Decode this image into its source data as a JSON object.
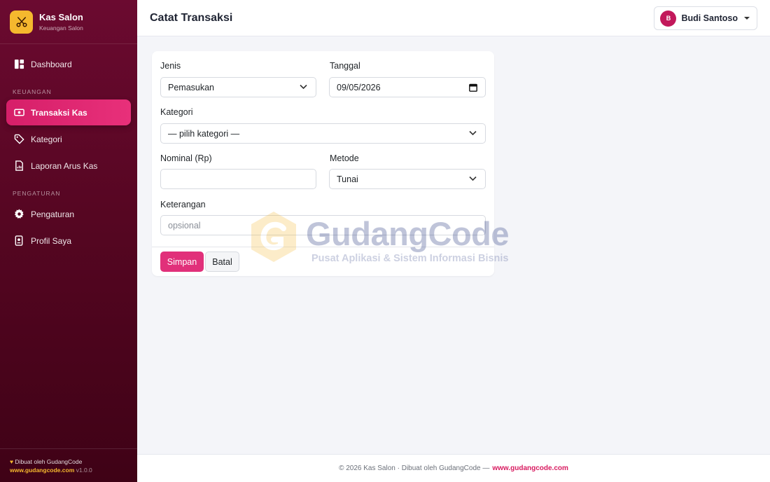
{
  "brand": {
    "title": "Kas Salon",
    "subtitle": "Keuangan Salon",
    "accent": "#f5b82e"
  },
  "sidebar": {
    "items": [
      {
        "label": "Dashboard",
        "icon": "dashboard-icon"
      },
      {
        "label": "Transaksi Kas",
        "icon": "cash-icon",
        "active": true
      },
      {
        "label": "Kategori",
        "icon": "tag-icon"
      },
      {
        "label": "Laporan Arus Kas",
        "icon": "report-icon"
      },
      {
        "label": "Pengaturan",
        "icon": "gear-icon"
      },
      {
        "label": "Profil Saya",
        "icon": "profile-icon"
      }
    ],
    "sections": [
      "KEUANGAN",
      "PENGATURAN"
    ],
    "footer": {
      "credit": "Dibuat oleh GudangCode",
      "link": "www.gudangcode.com",
      "version": "v1.0.0"
    }
  },
  "header": {
    "title": "Catat Transaksi",
    "user": {
      "initial": "B",
      "name": "Budi Santoso"
    }
  },
  "form": {
    "jenis": {
      "label": "Jenis",
      "value": "Pemasukan"
    },
    "tanggal": {
      "label": "Tanggal",
      "value": "09/05/2026"
    },
    "kategori": {
      "label": "Kategori",
      "value": "— pilih kategori —"
    },
    "nominal": {
      "label": "Nominal (Rp)",
      "value": ""
    },
    "metode": {
      "label": "Metode",
      "value": "Tunai"
    },
    "keterangan": {
      "label": "Keterangan",
      "placeholder": "opsional"
    },
    "save_label": "Simpan",
    "cancel_label": "Batal"
  },
  "watermark": {
    "title": "GudangCode",
    "subtitle": "Pusat Aplikasi & Sistem Informasi Bisnis"
  },
  "footer": {
    "text": "© 2026 Kas Salon · Dibuat oleh GudangCode —",
    "link": "www.gudangcode.com"
  },
  "colors": {
    "primary": "#e1307a",
    "sidebar": "#560622",
    "active_nav": "#d61f69"
  }
}
